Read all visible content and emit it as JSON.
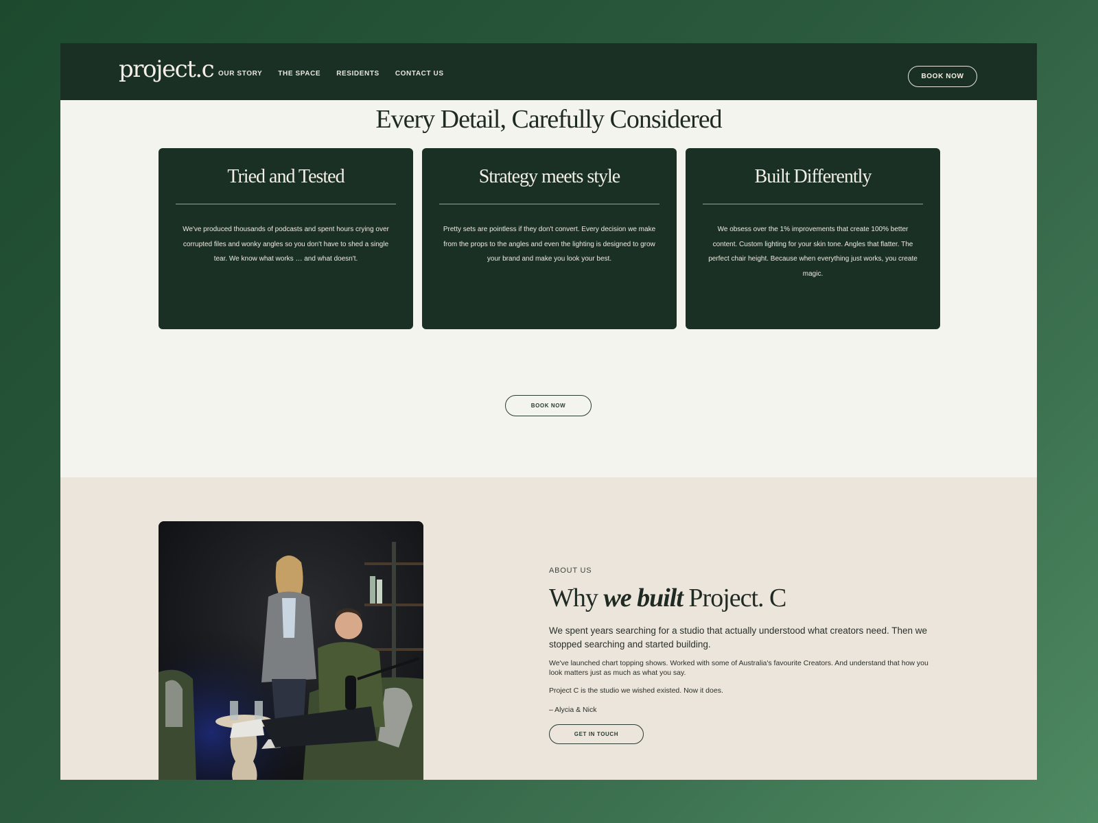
{
  "nav": {
    "logo": "project.c",
    "links": [
      "OUR STORY",
      "THE SPACE",
      "RESIDENTS",
      "CONTACT US"
    ],
    "book_label": "BOOK NOW"
  },
  "features": {
    "title": "Every Detail, Carefully Considered",
    "cards": [
      {
        "title": "Tried and Tested",
        "text": "We've produced thousands of podcasts and spent hours crying over corrupted files and wonky angles so you don't have to shed a single tear. We know what works … and what doesn't."
      },
      {
        "title": "Strategy meets style",
        "text": "Pretty sets are pointless if they don't convert.  Every decision we make from the props to the angles and even the lighting is designed to grow your brand and make you look your best."
      },
      {
        "title": "Built Differently",
        "text": "We obsess over the 1% improvements that create 100% better content. Custom lighting for your skin tone. Angles that flatter. The perfect chair height. Because when everything just works, you create magic."
      }
    ],
    "book_label": "BOOK NOW"
  },
  "about": {
    "label": "ABOUT US",
    "title_pre": "Why ",
    "title_em": "we built",
    "title_post": " Project. C",
    "lead": "We spent years searching for a studio that actually understood what creators need. Then we stopped searching and started building.",
    "p1": "We've launched chart topping shows. Worked with some of Australia's favourite Creators. And understand that how you look matters just as much as what you say.",
    "p2": "Project C is the studio we wished existed. Now it does.",
    "signature": "– Alycia & Nick",
    "cta_label": "GET IN TOUCH"
  }
}
